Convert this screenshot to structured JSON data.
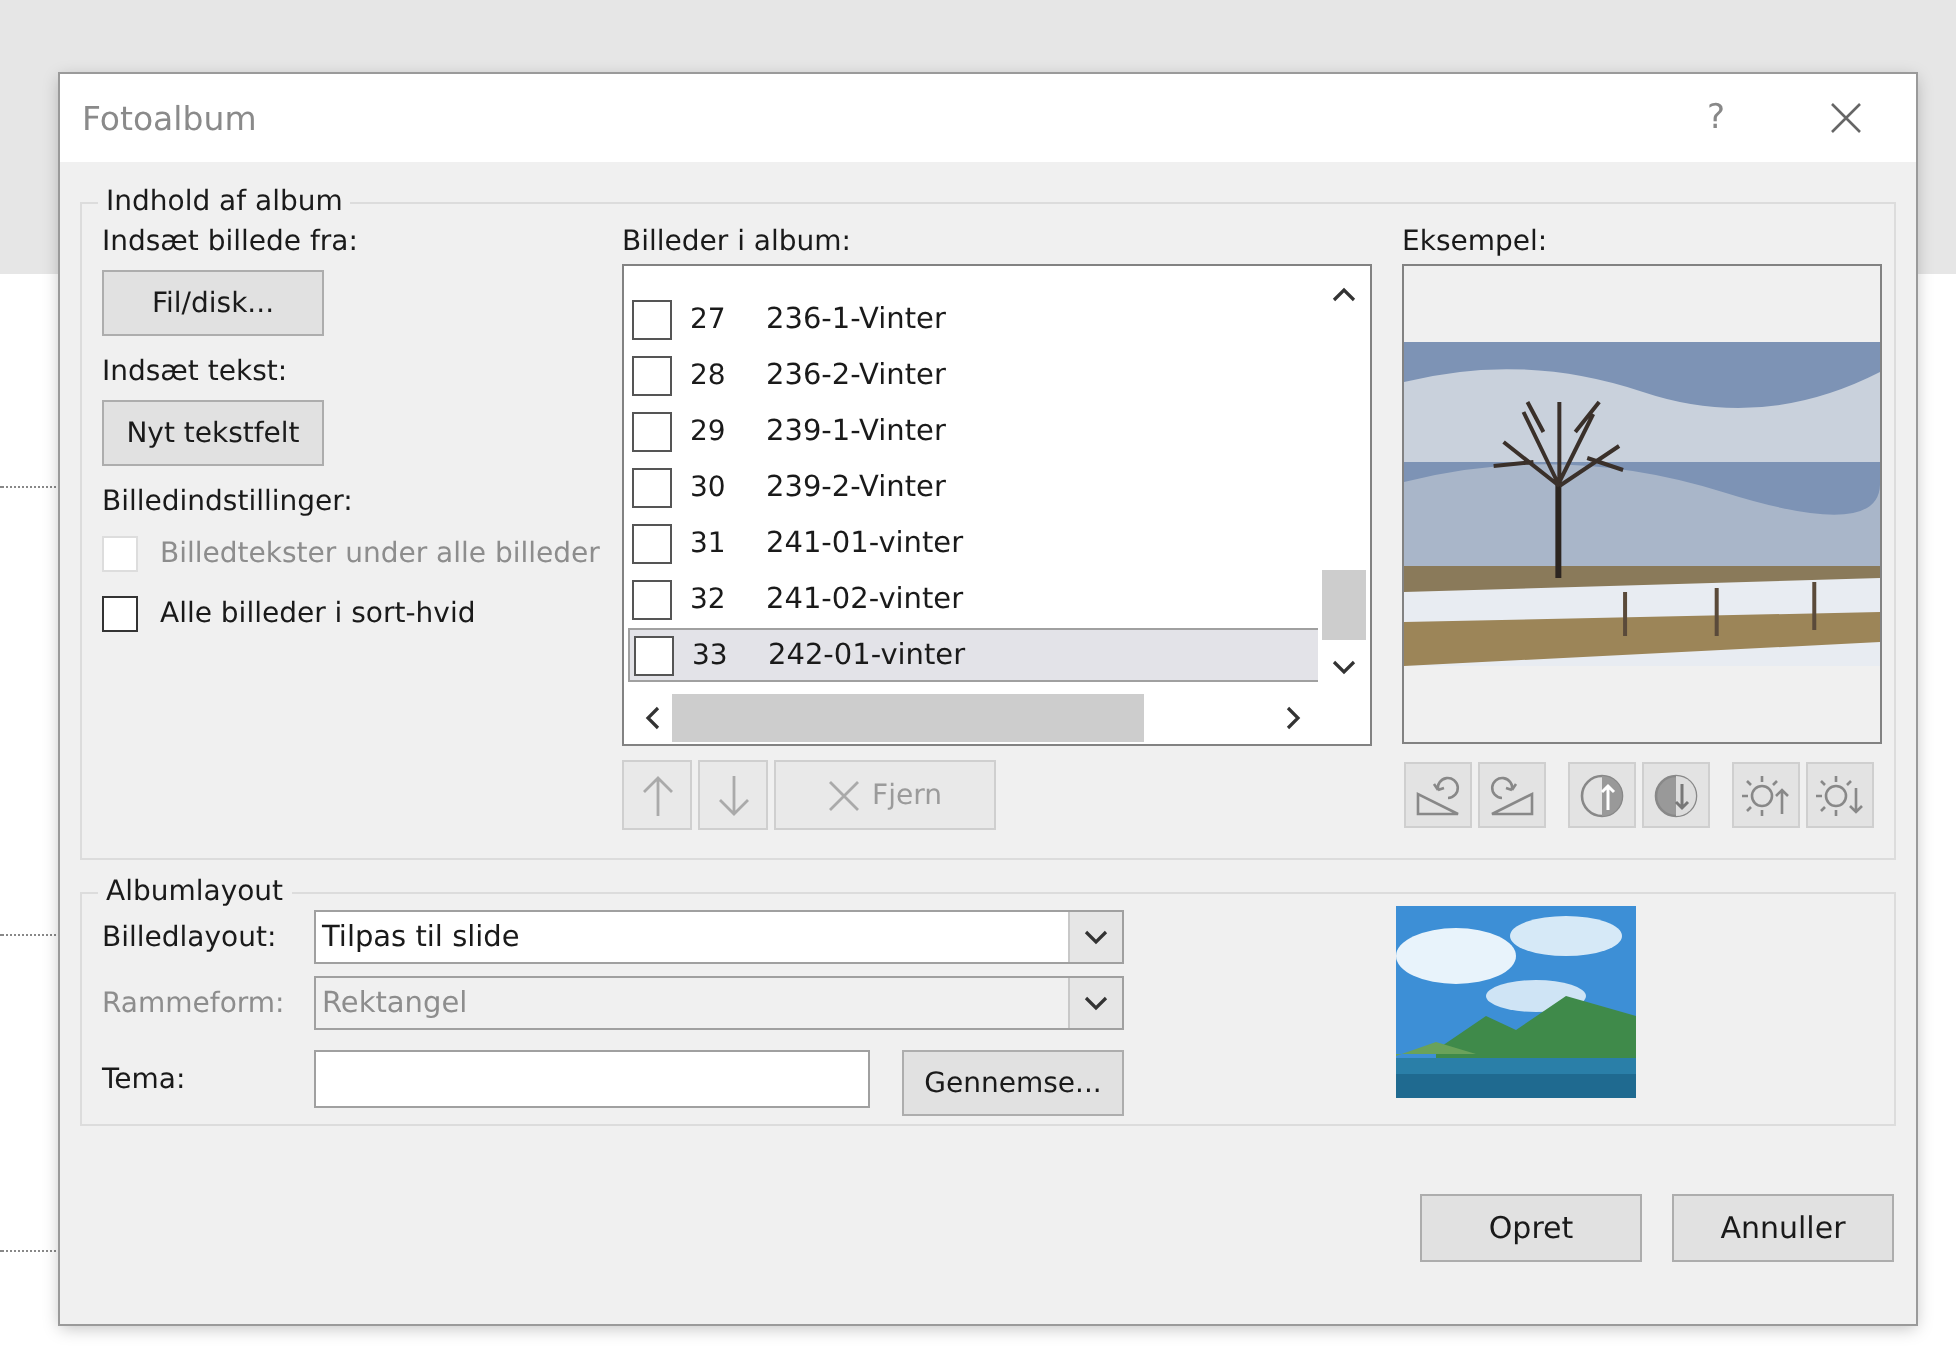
{
  "window": {
    "title": "Fotoalbum",
    "help": "?"
  },
  "album_content": {
    "legend": "Indhold af album",
    "insert_picture": {
      "label": "Indsæt billede fra:",
      "button": "Fil/disk..."
    },
    "insert_text": {
      "label": "Indsæt tekst:",
      "button": "Nyt tekstfelt"
    },
    "picture_options": {
      "label": "Billedindstillinger:",
      "checkboxes": [
        {
          "label": "Billedtekster under alle billeder",
          "checked": false,
          "disabled": true
        },
        {
          "label": "Alle billeder i sort-hvid",
          "checked": false,
          "disabled": false
        }
      ]
    },
    "pictures": {
      "label": "Billeder i album:",
      "items": [
        {
          "number": "27",
          "name": "236-1-Vinter",
          "checked": false,
          "selected": false
        },
        {
          "number": "28",
          "name": "236-2-Vinter",
          "checked": false,
          "selected": false
        },
        {
          "number": "29",
          "name": "239-1-Vinter",
          "checked": false,
          "selected": false
        },
        {
          "number": "30",
          "name": "239-2-Vinter",
          "checked": false,
          "selected": false
        },
        {
          "number": "31",
          "name": "241-01-vinter",
          "checked": false,
          "selected": false
        },
        {
          "number": "32",
          "name": "241-02-vinter",
          "checked": false,
          "selected": false
        },
        {
          "number": "33",
          "name": "242-01-vinter",
          "checked": false,
          "selected": true
        }
      ],
      "buttons": [
        {
          "kind": "up",
          "disabled": true
        },
        {
          "kind": "down",
          "disabled": true
        },
        {
          "kind": "remove",
          "label": "Fjern",
          "disabled": true
        }
      ]
    },
    "preview": {
      "label": "Eksempel:",
      "tools": [
        {
          "kind": "rotate-left"
        },
        {
          "kind": "rotate-right"
        },
        {
          "kind": "contrast-up"
        },
        {
          "kind": "contrast-down"
        },
        {
          "kind": "brightness-up"
        },
        {
          "kind": "brightness-down"
        }
      ]
    }
  },
  "album_layout": {
    "legend": "Albumlayout",
    "fields": [
      {
        "kind": "select",
        "label": "Billedlayout:",
        "value": "Tilpas til slide",
        "disabled": false
      },
      {
        "kind": "select",
        "label": "Rammeform:",
        "value": "Rektangel",
        "disabled": true
      },
      {
        "kind": "text",
        "label": "Tema:",
        "button": "Gennemse..."
      }
    ]
  },
  "buttons": [
    "Opret",
    "Annuller"
  ]
}
